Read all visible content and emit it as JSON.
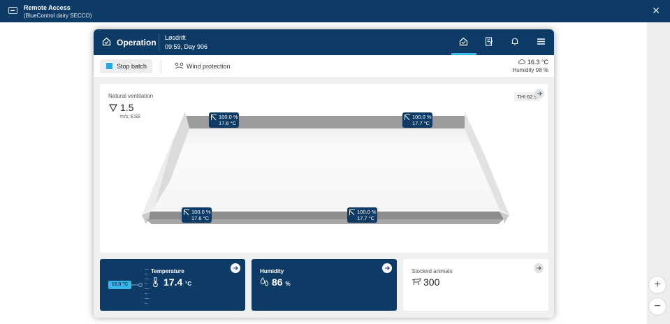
{
  "window": {
    "title": "Remote Access",
    "subtitle": "(BlueControl dairy SECCO)",
    "close_icon": "close-icon"
  },
  "header": {
    "section": "Operation",
    "mode": "Løsdrift",
    "time": "09:59, Day 906",
    "nav_icons": [
      "house-check-icon",
      "report-icon",
      "bell-icon",
      "menu-icon"
    ]
  },
  "toolbar": {
    "stop_batch": "Stop batch",
    "wind_protection": "Wind protection",
    "outdoor_temp": "16.3 °C",
    "outdoor_humidity": "Humidity 98 %"
  },
  "barn": {
    "ventilation_label": "Natural ventilation",
    "wind_speed": "1.5",
    "wind_unit": "m/s, ESE",
    "thi": "THI 62.9",
    "sensors": [
      {
        "opening": "100.0 %",
        "temp": "17.6 °C"
      },
      {
        "opening": "100.0 %",
        "temp": "17.7 °C"
      },
      {
        "opening": "100.0 %",
        "temp": "17.6 °C"
      },
      {
        "opening": "100.0 %",
        "temp": "17.7 °C"
      }
    ]
  },
  "cards": {
    "temperature": {
      "title": "Temperature",
      "setpoint": "10.0 °C",
      "value": "17.4",
      "unit": "°C"
    },
    "humidity": {
      "title": "Humidity",
      "value": "86",
      "unit": "%"
    },
    "animals": {
      "title": "Stocked animals",
      "value": "300"
    }
  },
  "colors": {
    "navy": "#0d3b66",
    "accent": "#39b6e8",
    "stop": "#2aa7e0"
  }
}
